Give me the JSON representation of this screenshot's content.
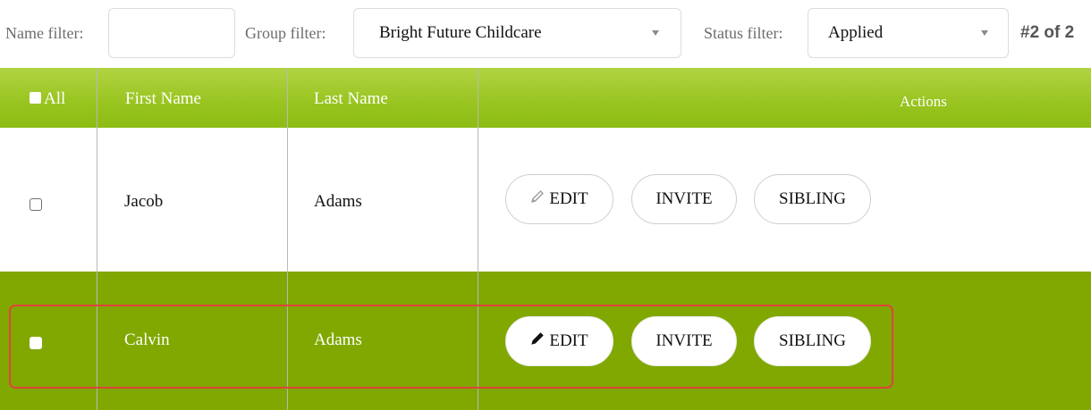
{
  "filters": {
    "name_label": "Name filter:",
    "name_value": "",
    "group_label": "Group filter:",
    "group_value": "Bright Future Childcare",
    "status_label": "Status filter:",
    "status_value": "Applied"
  },
  "pager": "#2 of 2",
  "table": {
    "headers": {
      "all": "All",
      "first_name": "First Name",
      "last_name": "Last Name",
      "actions": "Actions"
    },
    "rows": [
      {
        "first_name": "Jacob",
        "last_name": "Adams",
        "checked": false
      },
      {
        "first_name": "Calvin",
        "last_name": "Adams",
        "checked": false,
        "selected": true
      }
    ],
    "buttons": {
      "edit": "EDIT",
      "invite": "INVITE",
      "sibling": "SIBLING"
    }
  },
  "colors": {
    "header_green": "#98c41f",
    "selected_row_green": "#80a800",
    "highlight_red": "#e0453a"
  },
  "icons": [
    "pencil-icon",
    "chevron-down-icon"
  ]
}
